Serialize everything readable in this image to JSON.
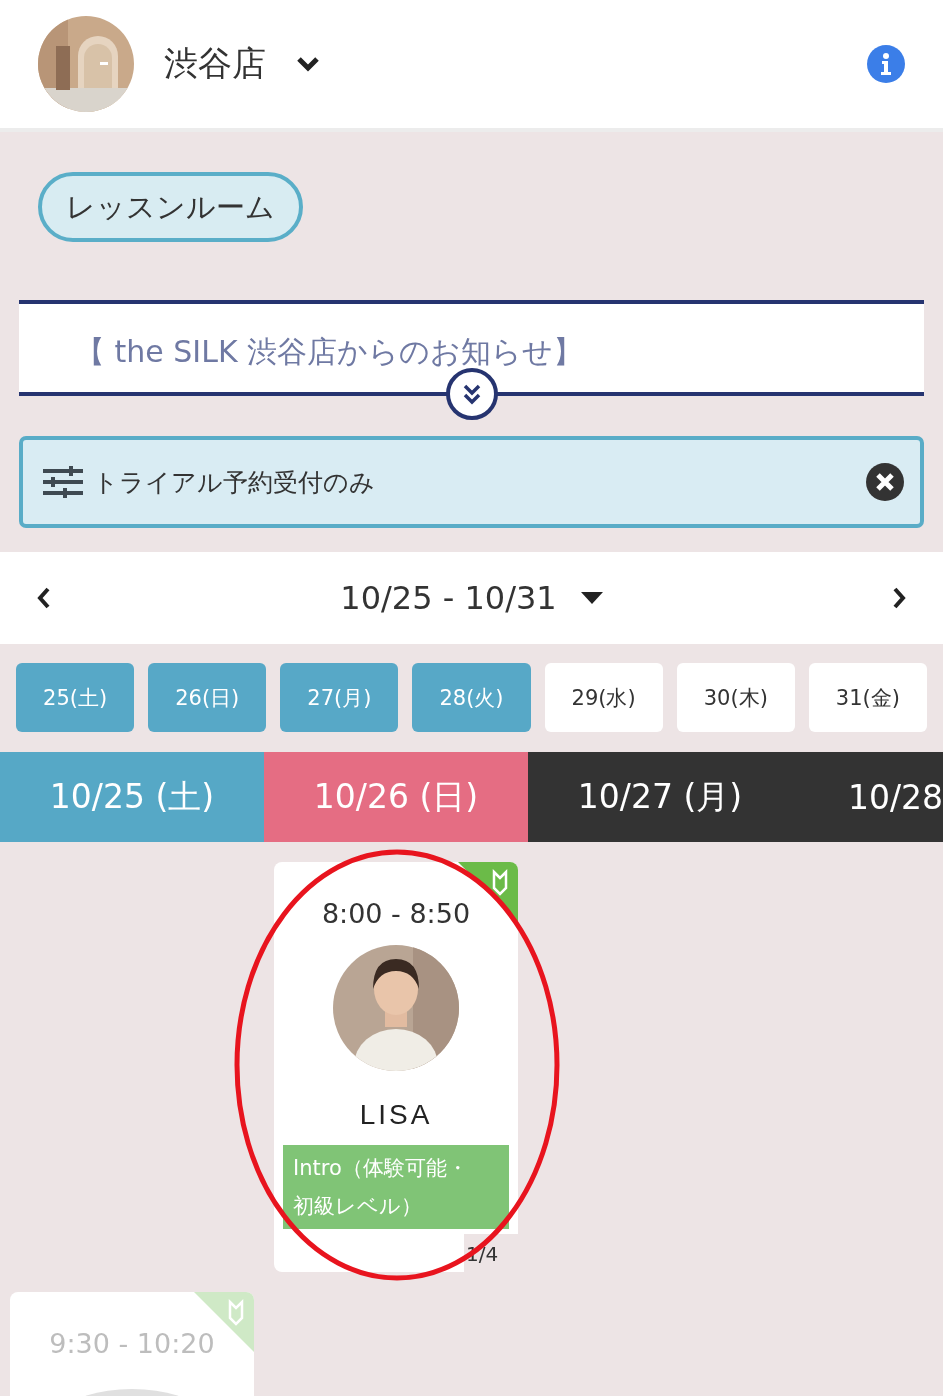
{
  "header": {
    "store_name": "渋谷店"
  },
  "room_chip": {
    "label": "レッスンルーム"
  },
  "notice": {
    "text": "【 the SILK 渋谷店からのお知らせ】"
  },
  "filter": {
    "label": "トライアル予約受付のみ"
  },
  "week_nav": {
    "range": "10/25 - 10/31"
  },
  "day_buttons": [
    {
      "label": "25(土)",
      "selected": true
    },
    {
      "label": "26(日)",
      "selected": true
    },
    {
      "label": "27(月)",
      "selected": true
    },
    {
      "label": "28(火)",
      "selected": true
    },
    {
      "label": "29(水)",
      "selected": false
    },
    {
      "label": "30(木)",
      "selected": false
    },
    {
      "label": "31(金)",
      "selected": false
    }
  ],
  "day_headers": [
    {
      "label": "10/25 (土)",
      "color": "#56a8c6"
    },
    {
      "label": "10/26 (日)",
      "color": "#e56d83"
    },
    {
      "label": "10/27 (月)",
      "color": "#333333"
    },
    {
      "label": "10/28",
      "color": "#333333"
    }
  ],
  "slots": [
    {
      "cells": [
        {
          "kind": "empty"
        },
        {
          "kind": "lesson",
          "time": "8:00 - 8:50",
          "instructor": "LISA",
          "tag": "Intro（体験可能・初級レベル）",
          "count": "1/4",
          "disabled": false,
          "circled": true
        }
      ]
    },
    {
      "cells": [
        {
          "kind": "lesson",
          "time": "9:30 - 10:20",
          "disabled": true,
          "circled": false
        }
      ]
    }
  ]
}
